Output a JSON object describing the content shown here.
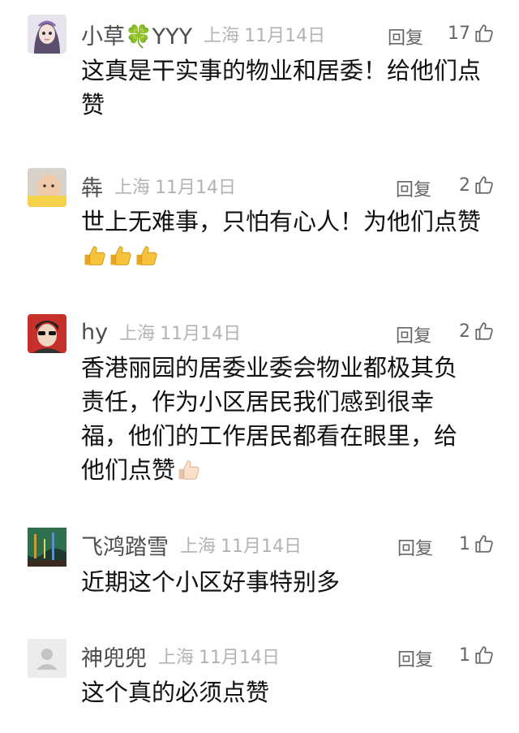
{
  "comments": [
    {
      "name": "小草🍀YYY",
      "location": "上海",
      "date": "11月14日",
      "reply_label": "回复",
      "likes": "17",
      "text": "这真是干实事的物业和居委！给他们点赞",
      "trailing_emoji": "",
      "avatar": "girl-avatar"
    },
    {
      "name": "犇",
      "location": "上海",
      "date": "11月14日",
      "reply_label": "回复",
      "likes": "2",
      "text": "世上无难事，只怕有心人！为他们点赞",
      "trailing_emoji": "thumbs-up-x3",
      "avatar": "baby-avatar"
    },
    {
      "name": "hy",
      "location": "上海",
      "date": "11月14日",
      "reply_label": "回复",
      "likes": "2",
      "text": "香港丽园的居委业委会物业都极其负责任，作为小区居民我们感到很幸福，他们的工作居民都看在眼里，给他们点赞",
      "trailing_emoji": "thumbs-up-light",
      "avatar": "sunglasses-avatar"
    },
    {
      "name": "飞鸿踏雪",
      "location": "上海",
      "date": "11月14日",
      "reply_label": "回复",
      "likes": "1",
      "text": "近期这个小区好事特别多",
      "trailing_emoji": "",
      "avatar": "painting-avatar"
    },
    {
      "name": "神兜兜",
      "location": "上海",
      "date": "11月14日",
      "reply_label": "回复",
      "likes": "1",
      "text": "这个真的必须点赞",
      "trailing_emoji": "",
      "avatar": "default-user-avatar"
    }
  ],
  "colors": {
    "name": "#4d4d4d",
    "meta": "#b3b3b3",
    "text": "#111111",
    "accent_thumb": "#f2b72a"
  }
}
